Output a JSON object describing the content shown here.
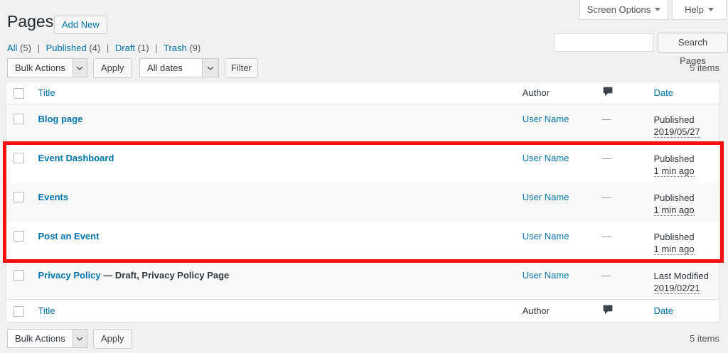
{
  "colors": {
    "accent_blue": "#0073aa",
    "highlight_red": "#f50f0f",
    "page_bg": "#f1f1f1",
    "stripe_bg": "#f9f9f9"
  },
  "header": {
    "page_title": "Pages",
    "add_new_label": "Add New",
    "screen_options_label": "Screen Options",
    "help_label": "Help"
  },
  "views": {
    "separator": "|",
    "links": [
      {
        "label": "All",
        "count": "(5)"
      },
      {
        "label": "Published",
        "count": "(4)"
      },
      {
        "label": "Draft",
        "count": "(1)"
      },
      {
        "label": "Trash",
        "count": "(9)"
      }
    ]
  },
  "search": {
    "value": "",
    "button_label": "Search Pages"
  },
  "tablenav": {
    "bulk_actions_label": "Bulk Actions",
    "apply_label": "Apply",
    "dates_label": "All dates",
    "filter_label": "Filter",
    "items_count": "5 items"
  },
  "table": {
    "columns": {
      "title": "Title",
      "author": "Author",
      "comments_icon": "comments",
      "date": "Date"
    },
    "rows": [
      {
        "title": "Blog page",
        "state": "",
        "author": "User Name",
        "comments": "—",
        "date_status": "Published",
        "date_value": "2019/05/27"
      },
      {
        "title": "Event Dashboard",
        "state": "",
        "author": "User Name",
        "comments": "—",
        "date_status": "Published",
        "date_value": "1 min ago"
      },
      {
        "title": "Events",
        "state": "",
        "author": "User Name",
        "comments": "—",
        "date_status": "Published",
        "date_value": "1 min ago"
      },
      {
        "title": "Post an Event",
        "state": "",
        "author": "User Name",
        "comments": "—",
        "date_status": "Published",
        "date_value": "1 min ago"
      },
      {
        "title": "Privacy Policy",
        "state": "— Draft, Privacy Policy Page",
        "author": "User Name",
        "comments": "—",
        "date_status": "Last Modified",
        "date_value": "2019/02/21"
      }
    ],
    "highlighted_rows": [
      "Event Dashboard",
      "Events",
      "Post an Event"
    ]
  }
}
